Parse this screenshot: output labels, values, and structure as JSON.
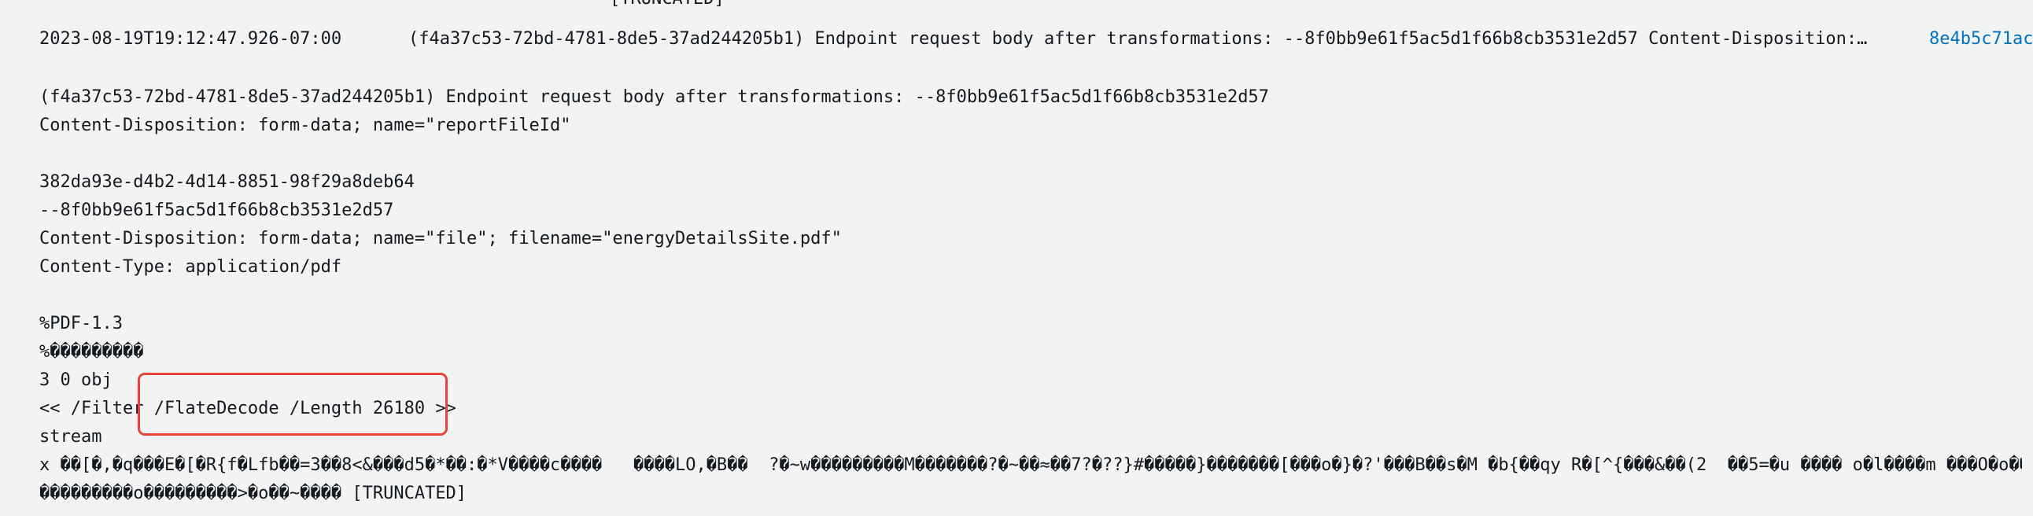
{
  "top_clip_text": "[TRUNCATED]",
  "log_event": {
    "timestamp": "2023-08-19T19:12:47.926-07:00",
    "summary_message": "(f4a37c53-72bd-4781-8de5-37ad244205b1) Endpoint request body after transformations: --8f0bb9e61f5ac5d1f66b8cb3531e2d57 Content-Disposition: fo…",
    "log_stream": "8e4b5c71ac",
    "detail_lines": [
      "(f4a37c53-72bd-4781-8de5-37ad244205b1) Endpoint request body after transformations: --8f0bb9e61f5ac5d1f66b8cb3531e2d57",
      "Content-Disposition: form-data; name=\"reportFileId\"",
      "",
      "382da93e-d4b2-4d14-8851-98f29a8deb64",
      "--8f0bb9e61f5ac5d1f66b8cb3531e2d57",
      "Content-Disposition: form-data; name=\"file\"; filename=\"energyDetailsSite.pdf\"",
      "Content-Type: application/pdf",
      "",
      "%PDF-1.3",
      "%���������",
      "3 0 obj",
      "<< /Filter /FlateDecode /Length 26180 >>",
      "stream",
      "x ��[�,�q���E�[�R{f�Lfb��=3��8<&���d5�*��:�*V����c����   ����LO,�B��  ?�~w���������M�������?�~��≈��7?�??}#�����}�������[���o�}�?'���B��s�M �b{��qy R�[^{���&��(2  ��5=�u ���� o�l����m ���O�o���ix n����",
      "���������o���������>�o��~���� [TRUNCATED]"
    ]
  },
  "highlight_color": "#e8453a",
  "link_color": "#0073bb"
}
